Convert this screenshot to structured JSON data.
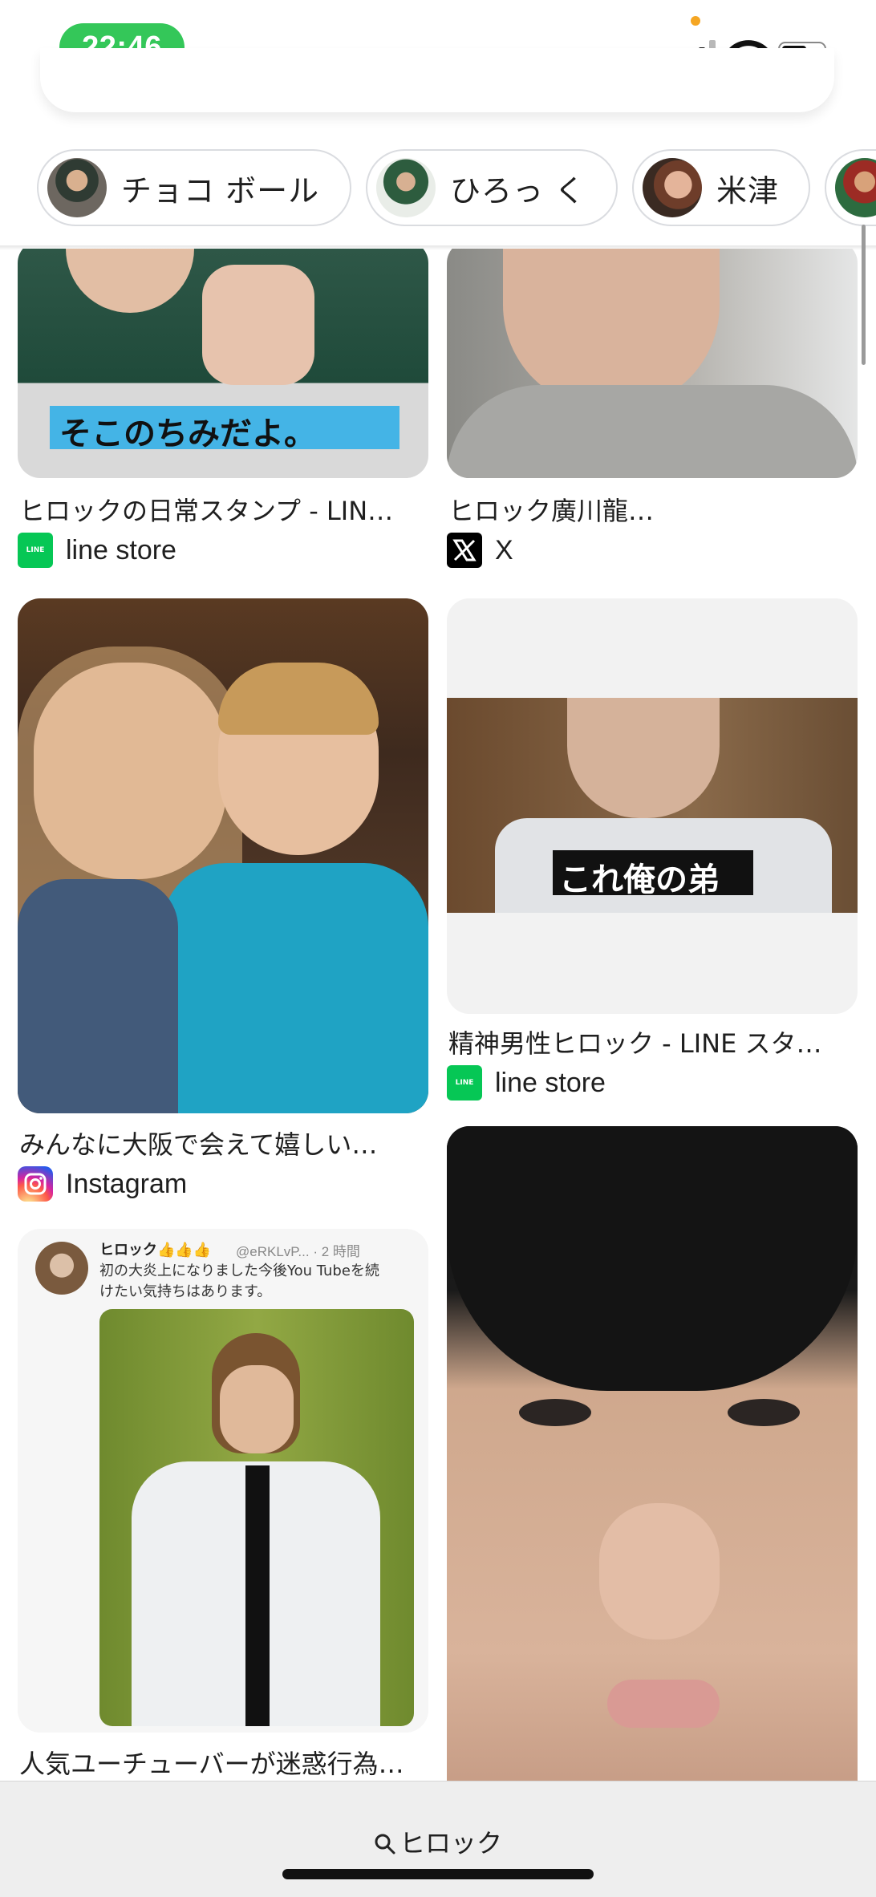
{
  "status_bar": {
    "time": "22:46"
  },
  "chips": [
    {
      "label": "チョコ ボール"
    },
    {
      "label": "ひろっ く"
    },
    {
      "label": "米津"
    }
  ],
  "results": [
    {
      "title": "ヒロックの日常スタンプ - LIN…",
      "source": "line store",
      "caption": "そこのちみだよ。"
    },
    {
      "title": "ヒロック廣川龍…",
      "source": "X"
    },
    {
      "title": "みんなに大阪で会えて嬉しい…",
      "source": "Instagram"
    },
    {
      "title": "精神男性ヒロック - LINE スタ…",
      "source": "line store",
      "caption": "これ俺の弟"
    },
    {
      "title": "人気ユーチューバーが迷惑行為…",
      "tweet_name": "ヒロック👍👍👍",
      "tweet_handle": "@eRKLvP... · 2 時間",
      "tweet_text": "初の大炎上になりました今後You Tubeを続けたい気持ちはあります。"
    },
    {
      "title": ""
    }
  ],
  "bottom_bar": {
    "query": "ヒロック"
  },
  "colors": {
    "time_pill": "#34c759",
    "line_green": "#06c755"
  }
}
